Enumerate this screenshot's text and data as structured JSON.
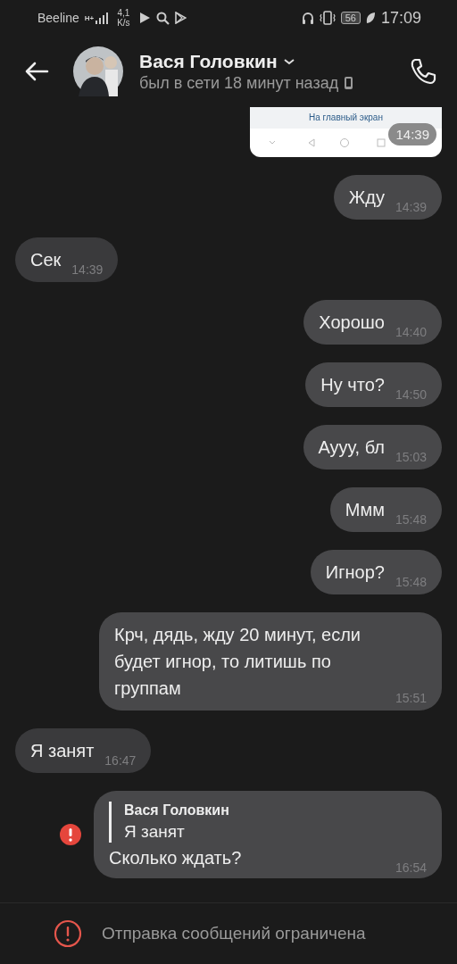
{
  "status_bar": {
    "carrier": "Beeline",
    "network": "H+",
    "speed_value": "4,1",
    "speed_unit": "K/s",
    "battery": "56",
    "time": "17:09"
  },
  "header": {
    "name": "Вася Головкин",
    "status": "был в сети 18 минут назад"
  },
  "messages": [
    {
      "kind": "image",
      "outgoing": true,
      "caption": "На главный экран",
      "time": "14:39"
    },
    {
      "kind": "text",
      "outgoing": true,
      "text": "Жду",
      "time": "14:39"
    },
    {
      "kind": "text",
      "outgoing": false,
      "text": "Сек",
      "time": "14:39"
    },
    {
      "kind": "text",
      "outgoing": true,
      "text": "Хорошо",
      "time": "14:40"
    },
    {
      "kind": "text",
      "outgoing": true,
      "text": "Ну что?",
      "time": "14:50"
    },
    {
      "kind": "text",
      "outgoing": true,
      "text": "Аууу, бл",
      "time": "15:03"
    },
    {
      "kind": "text",
      "outgoing": true,
      "text": "Ммм",
      "time": "15:48"
    },
    {
      "kind": "text",
      "outgoing": true,
      "text": "Игнор?",
      "time": "15:48"
    },
    {
      "kind": "text",
      "outgoing": true,
      "text": "Крч, дядь, жду 20 минут, если будет игнор, то литишь по группам",
      "time": "15:51"
    },
    {
      "kind": "text",
      "outgoing": false,
      "text": "Я занят",
      "time": "16:47"
    },
    {
      "kind": "reply",
      "outgoing": true,
      "failed": true,
      "quote_author": "Вася Головкин",
      "quote_text": "Я занят",
      "text": "Сколько ждать?",
      "time": "16:54"
    }
  ],
  "notice": "Отправка сообщений ограничена"
}
